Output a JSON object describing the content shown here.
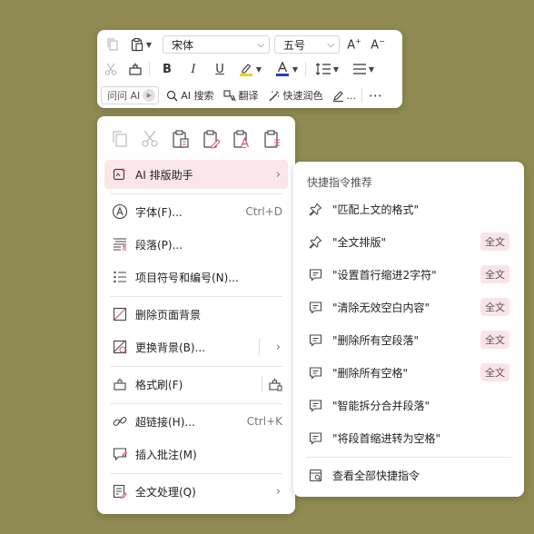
{
  "toolbar": {
    "font_name": "宋体",
    "font_size": "五号",
    "bold": "B",
    "italic": "I",
    "underline": "U",
    "ai_ask": "问问 AI",
    "ai_search": "AI 搜索",
    "translate": "翻译",
    "quick_color": "快速润色",
    "more": "..."
  },
  "context_menu": {
    "items": [
      {
        "label": "AI 排版助手"
      },
      {
        "label": "字体(F)...",
        "shortcut": "Ctrl+D"
      },
      {
        "label": "段落(P)..."
      },
      {
        "label": "项目符号和编号(N)..."
      },
      {
        "label": "删除页面背景"
      },
      {
        "label": "更换背景(B)..."
      },
      {
        "label": "格式刷(F)"
      },
      {
        "label": "超链接(H)...",
        "shortcut": "Ctrl+K"
      },
      {
        "label": "插入批注(M)"
      },
      {
        "label": "全文处理(Q)"
      }
    ]
  },
  "submenu": {
    "header": "快捷指令推荐",
    "items": [
      {
        "label": "\"匹配上文的格式\"",
        "tag": ""
      },
      {
        "label": "\"全文排版\"",
        "tag": "全文"
      },
      {
        "label": "\"设置首行缩进2字符\"",
        "tag": "全文"
      },
      {
        "label": "\"清除无效空白内容\"",
        "tag": "全文"
      },
      {
        "label": "\"删除所有空段落\"",
        "tag": "全文"
      },
      {
        "label": "\"删除所有空格\"",
        "tag": "全文"
      },
      {
        "label": "\"智能拆分合并段落\"",
        "tag": ""
      },
      {
        "label": "\"将段首缩进转为空格\"",
        "tag": ""
      }
    ],
    "view_all": "查看全部快捷指令"
  },
  "colors": {
    "background": "#8f8a52",
    "highlight_row": "#fbe6ea",
    "tag_bg": "#fbe4e8",
    "highlight_color_bar": "#f3d200",
    "font_color_bar": "#1f3fd1"
  }
}
